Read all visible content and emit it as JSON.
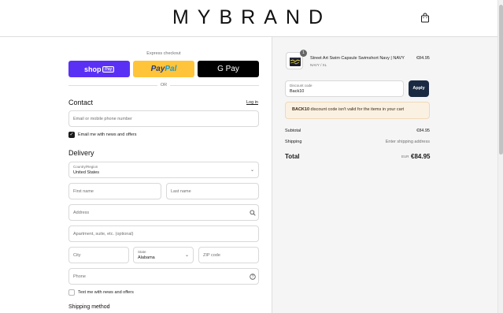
{
  "brand": "MYBRAND",
  "express": {
    "title": "Express checkout",
    "shop_pay": "shop",
    "shop_pay_badge": "Pay",
    "paypal_a": "Pay",
    "paypal_b": "Pal",
    "gpay": "G Pay",
    "or": "OR"
  },
  "contact": {
    "heading": "Contact",
    "login": "Log in",
    "email_placeholder": "Email or mobile phone number",
    "news_label": "Email me with news and offers"
  },
  "delivery": {
    "heading": "Delivery",
    "country_label": "Country/Region",
    "country_value": "United States",
    "first_name": "First name",
    "last_name": "Last name",
    "address": "Address",
    "apartment": "Apartment, suite, etc. (optional)",
    "city": "City",
    "state_label": "State",
    "state_value": "Alabama",
    "zip": "ZIP code",
    "phone": "Phone",
    "text_label": "Text me with news and offers"
  },
  "shipping_method": {
    "heading": "Shipping method"
  },
  "summary": {
    "qty": "1",
    "product_name": "Street Art Swim Capsule Swimshort Navy | NAVY",
    "product_variant": "NAVY / XL",
    "product_price": "€84.95",
    "discount_label": "Discount code",
    "discount_value": "Back10",
    "apply": "Apply",
    "warning_code": "BACK10",
    "warning_text": " discount code isn't valid for the items in your cart",
    "subtotal_label": "Subtotal",
    "subtotal_value": "€84.95",
    "shipping_label": "Shipping",
    "shipping_value": "Enter shipping address",
    "total_label": "Total",
    "total_currency": "EUR",
    "total_value": "€84.95"
  }
}
